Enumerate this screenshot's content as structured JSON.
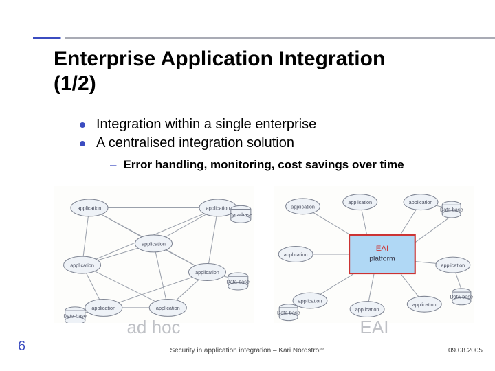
{
  "title_line1": "Enterprise Application Integration",
  "title_line2": "(1/2)",
  "bullets": {
    "b1": "Integration within a single enterprise",
    "b2": "A centralised integration solution",
    "sub1": "Error handling, monitoring, cost savings over time"
  },
  "diagram_left": {
    "caption": "ad hoc",
    "nodes": {
      "app": "application",
      "db": "Data-base"
    }
  },
  "diagram_right": {
    "caption": "EAI",
    "platform_line1": "EAI",
    "platform_line2": "platform",
    "nodes": {
      "app": "application",
      "db": "Data-base"
    }
  },
  "footer": {
    "page": "6",
    "center": "Security in application integration – Kari Nordström",
    "date": "09.08.2005"
  }
}
